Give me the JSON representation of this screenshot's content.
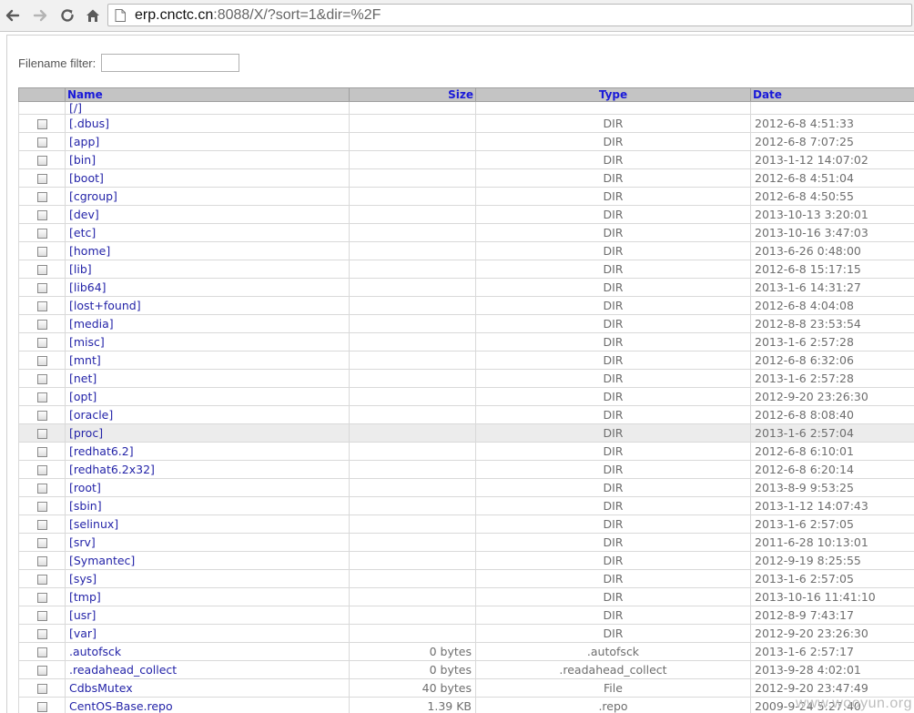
{
  "browser": {
    "url_host": "erp.cnctc.cn",
    "url_rest": ":8088/X/?sort=1&dir=%2F"
  },
  "filter": {
    "label": "Filename filter:",
    "value": ""
  },
  "table": {
    "headers": {
      "name": "Name",
      "size": "Size",
      "type": "Type",
      "date": "Date"
    },
    "root_link": "[/]",
    "rows": [
      {
        "name": "[.dbus]",
        "size": "",
        "type": "DIR",
        "date": "2012-6-8 4:51:33"
      },
      {
        "name": "[app]",
        "size": "",
        "type": "DIR",
        "date": "2012-6-8 7:07:25"
      },
      {
        "name": "[bin]",
        "size": "",
        "type": "DIR",
        "date": "2013-1-12 14:07:02"
      },
      {
        "name": "[boot]",
        "size": "",
        "type": "DIR",
        "date": "2012-6-8 4:51:04"
      },
      {
        "name": "[cgroup]",
        "size": "",
        "type": "DIR",
        "date": "2012-6-8 4:50:55"
      },
      {
        "name": "[dev]",
        "size": "",
        "type": "DIR",
        "date": "2013-10-13 3:20:01"
      },
      {
        "name": "[etc]",
        "size": "",
        "type": "DIR",
        "date": "2013-10-16 3:47:03"
      },
      {
        "name": "[home]",
        "size": "",
        "type": "DIR",
        "date": "2013-6-26 0:48:00"
      },
      {
        "name": "[lib]",
        "size": "",
        "type": "DIR",
        "date": "2012-6-8 15:17:15"
      },
      {
        "name": "[lib64]",
        "size": "",
        "type": "DIR",
        "date": "2013-1-6 14:31:27"
      },
      {
        "name": "[lost+found]",
        "size": "",
        "type": "DIR",
        "date": "2012-6-8 4:04:08"
      },
      {
        "name": "[media]",
        "size": "",
        "type": "DIR",
        "date": "2012-8-8 23:53:54"
      },
      {
        "name": "[misc]",
        "size": "",
        "type": "DIR",
        "date": "2013-1-6 2:57:28"
      },
      {
        "name": "[mnt]",
        "size": "",
        "type": "DIR",
        "date": "2012-6-8 6:32:06"
      },
      {
        "name": "[net]",
        "size": "",
        "type": "DIR",
        "date": "2013-1-6 2:57:28"
      },
      {
        "name": "[opt]",
        "size": "",
        "type": "DIR",
        "date": "2012-9-20 23:26:30"
      },
      {
        "name": "[oracle]",
        "size": "",
        "type": "DIR",
        "date": "2012-6-8 8:08:40"
      },
      {
        "name": "[proc]",
        "size": "",
        "type": "DIR",
        "date": "2013-1-6 2:57:04"
      },
      {
        "name": "[redhat6.2]",
        "size": "",
        "type": "DIR",
        "date": "2012-6-8 6:10:01"
      },
      {
        "name": "[redhat6.2x32]",
        "size": "",
        "type": "DIR",
        "date": "2012-6-8 6:20:14"
      },
      {
        "name": "[root]",
        "size": "",
        "type": "DIR",
        "date": "2013-8-9 9:53:25"
      },
      {
        "name": "[sbin]",
        "size": "",
        "type": "DIR",
        "date": "2013-1-12 14:07:43"
      },
      {
        "name": "[selinux]",
        "size": "",
        "type": "DIR",
        "date": "2013-1-6 2:57:05"
      },
      {
        "name": "[srv]",
        "size": "",
        "type": "DIR",
        "date": "2011-6-28 10:13:01"
      },
      {
        "name": "[Symantec]",
        "size": "",
        "type": "DIR",
        "date": "2012-9-19 8:25:55"
      },
      {
        "name": "[sys]",
        "size": "",
        "type": "DIR",
        "date": "2013-1-6 2:57:05"
      },
      {
        "name": "[tmp]",
        "size": "",
        "type": "DIR",
        "date": "2013-10-16 11:41:10"
      },
      {
        "name": "[usr]",
        "size": "",
        "type": "DIR",
        "date": "2012-8-9 7:43:17"
      },
      {
        "name": "[var]",
        "size": "",
        "type": "DIR",
        "date": "2012-9-20 23:26:30"
      },
      {
        "name": ".autofsck",
        "size": "0 bytes",
        "type": ".autofsck",
        "date": "2013-1-6 2:57:17"
      },
      {
        "name": ".readahead_collect",
        "size": "0 bytes",
        "type": ".readahead_collect",
        "date": "2013-9-28 4:02:01"
      },
      {
        "name": "CdbsMutex",
        "size": "40 bytes",
        "type": "File",
        "date": "2012-9-20 23:47:49"
      },
      {
        "name": "CentOS-Base.repo",
        "size": "1.39 KB",
        "type": ".repo",
        "date": "2009-9-24 5:27:40"
      }
    ]
  },
  "watermark": "www.wooyun.org"
}
